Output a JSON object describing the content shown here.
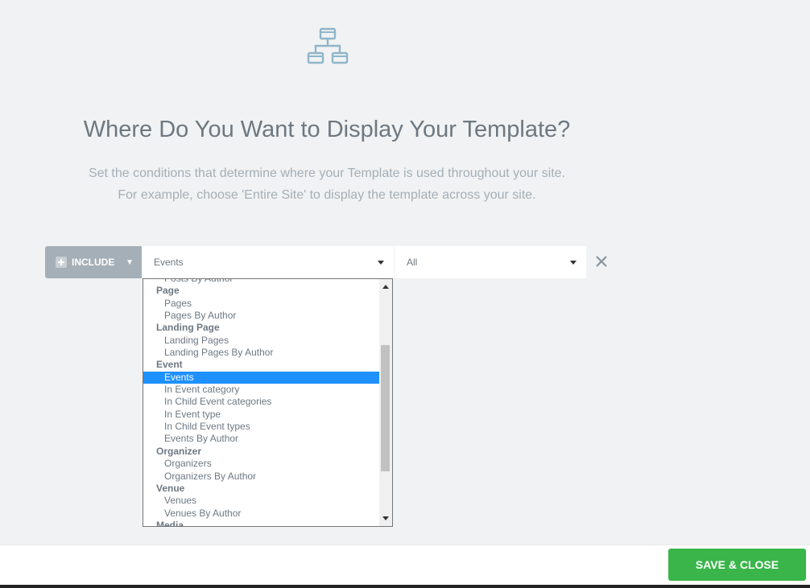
{
  "header": {
    "icon": "sitemap-icon",
    "title": "Where Do You Want to Display Your Template?",
    "description_line1": "Set the conditions that determine where your Template is used throughout your site.",
    "description_line2": "For example, choose 'Entire Site' to display the template across your site."
  },
  "condition": {
    "include_label": "INCLUDE",
    "type_value": "Events",
    "sub_value": "All"
  },
  "dropdown": {
    "partial_top": "Posts By Author",
    "items": [
      {
        "kind": "group",
        "label": "Page"
      },
      {
        "kind": "option",
        "label": "Pages"
      },
      {
        "kind": "option",
        "label": "Pages By Author"
      },
      {
        "kind": "group",
        "label": "Landing Page"
      },
      {
        "kind": "option",
        "label": "Landing Pages"
      },
      {
        "kind": "option",
        "label": "Landing Pages By Author"
      },
      {
        "kind": "group",
        "label": "Event"
      },
      {
        "kind": "option",
        "label": "Events",
        "selected": true
      },
      {
        "kind": "option",
        "label": "In Event category"
      },
      {
        "kind": "option",
        "label": "In Child Event categories"
      },
      {
        "kind": "option",
        "label": "In Event type"
      },
      {
        "kind": "option",
        "label": "In Child Event types"
      },
      {
        "kind": "option",
        "label": "Events By Author"
      },
      {
        "kind": "group",
        "label": "Organizer"
      },
      {
        "kind": "option",
        "label": "Organizers"
      },
      {
        "kind": "option",
        "label": "Organizers By Author"
      },
      {
        "kind": "group",
        "label": "Venue"
      },
      {
        "kind": "option",
        "label": "Venues"
      },
      {
        "kind": "option",
        "label": "Venues By Author"
      }
    ],
    "partial_bottom": "Media"
  },
  "footer": {
    "save_label": "SAVE & CLOSE"
  },
  "colors": {
    "selected_option": "#1e90ff",
    "save_button": "#39b54a",
    "include_button": "#a4afb7"
  }
}
